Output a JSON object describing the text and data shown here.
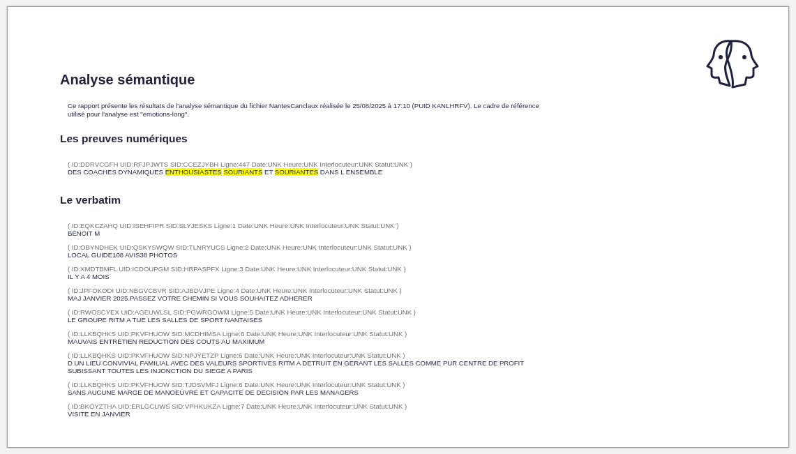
{
  "title": "Analyse sémantique",
  "intro": "Ce rapport présente les résultats de l'analyse sémantique du fichier NantesCanclaux réalisée le 25/08/2025 à 17:10 (PUID KANLHRFV). Le cadre de référence utilisé pour l'analyse est \"emotions-long\".",
  "evidence": {
    "heading": "Les preuves numériques",
    "entries": [
      {
        "meta": "( ID:DDRVCGFH UID:RFJPJWTS SID:CCEZJYBH Ligne:447 Date:UNK Heure:UNK Interlocuteur:UNK Statut:UNK )",
        "segments": [
          {
            "text": "DES COACHES DYNAMIQUES",
            "highlighted": false
          },
          {
            "text": "ENTHOUSIASTES",
            "highlighted": true
          },
          {
            "text": "SOURIANTS",
            "highlighted": true
          },
          {
            "text": "ET",
            "highlighted": false
          },
          {
            "text": "SOURIANTES",
            "highlighted": true
          },
          {
            "text": "DANS L ENSEMBLE",
            "highlighted": false
          }
        ]
      }
    ]
  },
  "verbatim": {
    "heading": "Le verbatim",
    "entries": [
      {
        "meta": "( ID:EQKCZAHQ UID:ISEHFIPR SID:SLYJESKS Ligne:1 Date:UNK Heure:UNK Interlocuteur:UNK Statut:UNK )",
        "text": "BENOIT M"
      },
      {
        "meta": "( ID:OBYNDHEK UID:QSKYSWQW SID:TLNRYUCS Ligne:2 Date:UNK Heure:UNK Interlocuteur:UNK Statut:UNK )",
        "text": "LOCAL GUIDE108 AVIS38 PHOTOS"
      },
      {
        "meta": "( ID:XMDTBMFL UID:ICDOUPGM SID:HRPASPFX Ligne:3 Date:UNK Heure:UNK Interlocuteur:UNK Statut:UNK )",
        "text": "IL Y A 4 MOIS"
      },
      {
        "meta": "( ID:JPFOKODI UID:NBGVCBVR SID:AJBDVJPE Ligne:4 Date:UNK Heure:UNK Interlocuteur:UNK Statut:UNK )",
        "text": "MAJ JANVIER 2025.PASSEZ VOTRE CHEMIN SI VOUS SOUHAITEZ ADHERER"
      },
      {
        "meta": "( ID:RWOSCYEX UID:AGEUWLSL SID:PGWRGOWM Ligne:5 Date:UNK Heure:UNK Interlocuteur:UNK Statut:UNK )",
        "text": "LE GROUPE RITM A TUE LES SALLES DE SPORT NANTAISES"
      },
      {
        "meta": "( ID:LLKBQHKS UID:PKVFHUOW SID:MCDHIMSA Ligne:6 Date:UNK Heure:UNK Interlocuteur:UNK Statut:UNK )",
        "text": "MAUVAIS ENTRETIEN REDUCTION DES COUTS AU MAXIMUM"
      },
      {
        "meta": "( ID:LLKBQHKS UID:PKVFHUOW SID:NPJYETZP Ligne:6 Date:UNK Heure:UNK Interlocuteur:UNK Statut:UNK )",
        "text": "D UN LIEU CONVIVIAL FAMILIAL AVEC DES VALEURS SPORTIVES RITM A DETRUIT EN GERANT LES SALLES COMME PUR CENTRE DE PROFIT SUBISSANT TOUTES LES INJONCTION DU SIEGE A PARIS"
      },
      {
        "meta": "( ID:LLKBQHKS UID:PKVFHUOW SID:TJDSVMFJ Ligne:6 Date:UNK Heure:UNK Interlocuteur:UNK Statut:UNK )",
        "text": "SANS AUCUNE MARGE DE MANOEUVRE ET CAPACITE DE DECISION PAR LES MANAGERS"
      },
      {
        "meta": "( ID:BKOYZTHA UID:ERLGCUWS SID:VPHKUKZA Ligne:7 Date:UNK Heure:UNK Interlocuteur:UNK Statut:UNK )",
        "text": "VISITE EN JANVIER"
      }
    ]
  }
}
